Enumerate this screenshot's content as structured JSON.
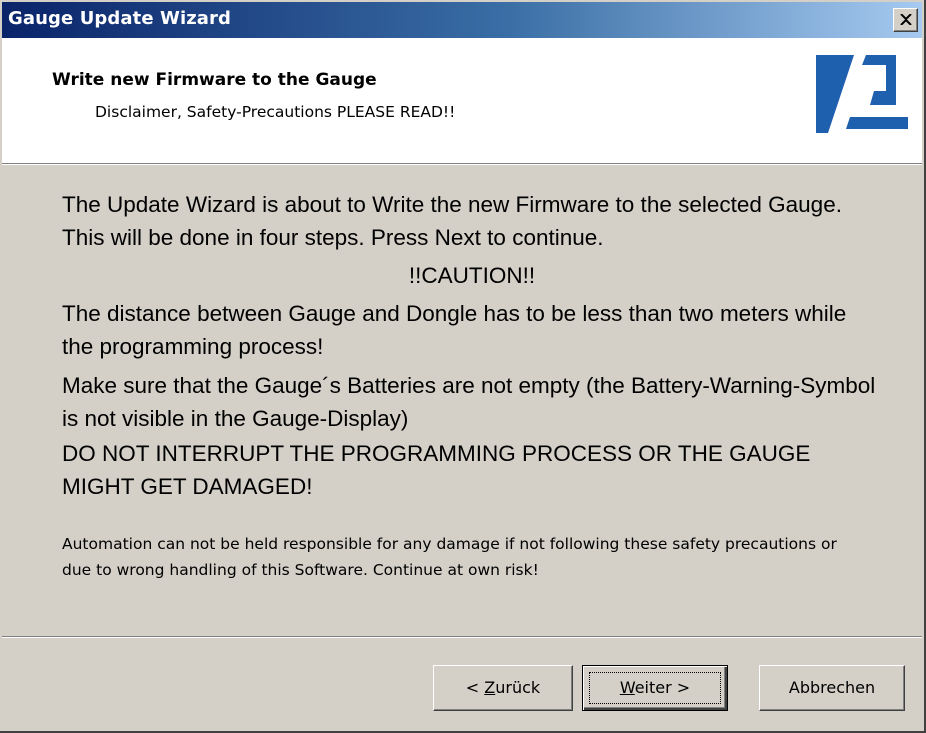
{
  "window": {
    "title": "Gauge Update Wizard",
    "close_icon": "close-icon"
  },
  "header": {
    "title": "Write new Firmware to the Gauge",
    "subtitle": "Disclaimer, Safety-Precautions PLEASE READ!!",
    "logo_icon": "brand-logo",
    "logo_color": "#1e5fae"
  },
  "content": {
    "intro": "The Update Wizard is about to Write the new Firmware to the selected Gauge. This will be done in four steps. Press Next to continue.",
    "caution": "!!CAUTION!!",
    "distance": "The distance between Gauge and Dongle has to be less than two meters while the programming process!",
    "batteries": "Make sure that the Gauge´s Batteries are not empty (the Battery-Warning-Symbol is not visible in the Gauge-Display)",
    "interrupt": "DO NOT INTERRUPT THE PROGRAMMING PROCESS OR THE GAUGE MIGHT GET DAMAGED!",
    "disclaimer": "Automation can not be held responsible for any damage if not following these safety precautions or due to wrong handling of this Software. Continue at own risk!"
  },
  "buttons": {
    "back": {
      "prefix": "< ",
      "mnemonic": "Z",
      "rest": "urück"
    },
    "next": {
      "mnemonic": "W",
      "rest": "eiter >"
    },
    "cancel": "Abbrechen"
  }
}
